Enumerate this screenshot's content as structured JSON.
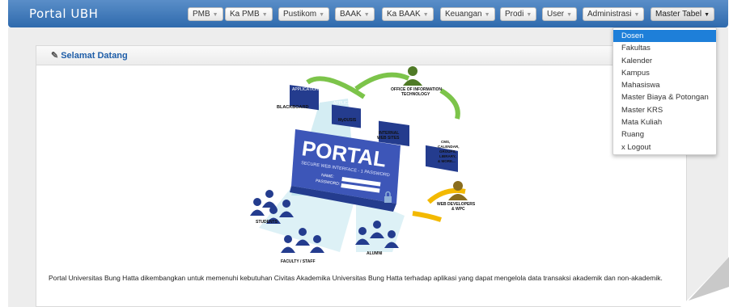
{
  "brand": "Portal UBH",
  "nav": [
    {
      "label": "PMB"
    },
    {
      "label": "Ka PMB"
    },
    {
      "label": "Pustikom"
    },
    {
      "label": "BAAK"
    },
    {
      "label": "Ka BAAK"
    },
    {
      "label": "Keuangan"
    },
    {
      "label": "Prodi"
    },
    {
      "label": "User"
    },
    {
      "label": "Administrasi"
    },
    {
      "label": "Master Tabel"
    }
  ],
  "dropdown": {
    "items": [
      "Dosen",
      "Fakultas",
      "Kalender",
      "Kampus",
      "Mahasiswa",
      "Master Biaya & Potongan",
      "Master KRS",
      "Mata Kuliah",
      "Ruang",
      "x Logout"
    ],
    "highlighted": "Dosen"
  },
  "panel": {
    "title": "Selamat Datang",
    "intro": "Portal Universitas Bung Hatta dikembangkan untuk memenuhi kebutuhan Civitas Akademika Universitas Bung Hatta terhadap aplikasi yang dapat mengelola data transaksi akademik dan non-akademik."
  },
  "illustration": {
    "portal_title": "PORTAL",
    "portal_subtitle": "SECURE WEB INTERFACE - 1 PASSWORD",
    "name_label": "NAME:",
    "password_label": "PASSWORD:",
    "blackboard": "BLACKBOARD",
    "application": "APPLICATION",
    "mydusis": "MyDUSIS",
    "web_pages": "WEB PAGES",
    "internal_sites": [
      "INTERNAL",
      "WEB SITES"
    ],
    "other_systems": [
      "OTHER",
      "SYSTEMS"
    ],
    "oit": [
      "OFFICE OF INFORMATION",
      "TECHNOLOGY"
    ],
    "cms_lines": [
      "CMS,",
      "CALENDAR,",
      "GROUPS,",
      "LIBRARY,",
      "& MORE..."
    ],
    "web_dev": [
      "WEB DEVELOPERS",
      "& WPC"
    ],
    "students": "STUDENTS",
    "faculty": "FACULTY / STAFF",
    "alumni": "ALUMNI"
  },
  "colors": {
    "navbar": "#3a76b8",
    "dropdown_active": "#1e7fd9",
    "link": "#1f5ea8"
  }
}
